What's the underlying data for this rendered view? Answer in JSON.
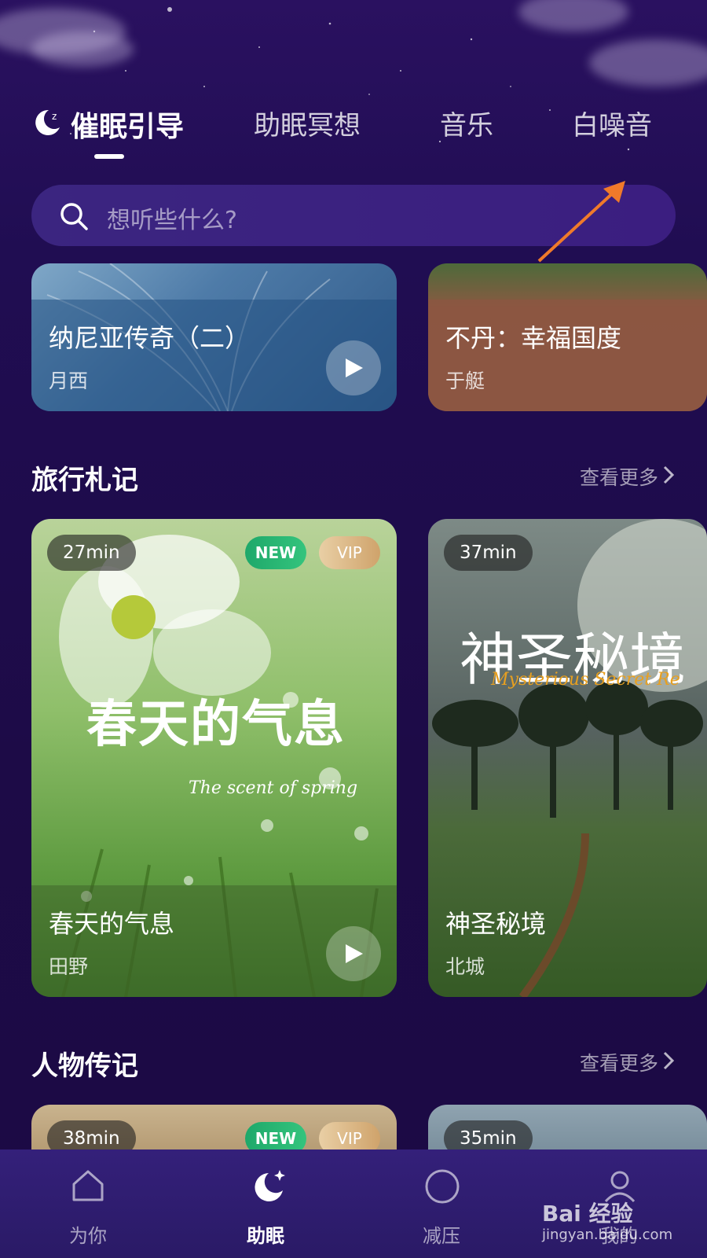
{
  "tabs": [
    {
      "label": "催眠引导",
      "active": true
    },
    {
      "label": "助眠冥想",
      "active": false
    },
    {
      "label": "音乐",
      "active": false
    },
    {
      "label": "白噪音",
      "active": false
    }
  ],
  "search": {
    "placeholder": "想听些什么?"
  },
  "top_cards": [
    {
      "title": "纳尼亚传奇（二）",
      "author": "月西"
    },
    {
      "title": "不丹：幸福国度",
      "author": "于艇"
    }
  ],
  "sections": [
    {
      "title": "旅行札记",
      "more": "查看更多",
      "cards": [
        {
          "duration": "27min",
          "new_badge": "NEW",
          "vip_badge": "VIP",
          "cover_title": "春天的气息",
          "cover_subtitle": "The scent of spring",
          "title": "春天的气息",
          "author": "田野"
        },
        {
          "duration": "37min",
          "cover_title": "神圣秘境",
          "cover_subtitle": "Mysterious Secret Re",
          "title": "神圣秘境",
          "author": "北城"
        }
      ]
    },
    {
      "title": "人物传记",
      "more": "查看更多",
      "cards": [
        {
          "duration": "38min",
          "new_badge": "NEW",
          "vip_badge": "VIP"
        },
        {
          "duration": "35min"
        }
      ]
    }
  ],
  "bottom_nav": [
    {
      "label": "为你",
      "icon": "home-icon",
      "active": false
    },
    {
      "label": "助眠",
      "icon": "moon-icon",
      "active": true
    },
    {
      "label": "减压",
      "icon": "circle-icon",
      "active": false
    },
    {
      "label": "我的",
      "icon": "profile-icon",
      "active": false
    }
  ],
  "watermark": {
    "brand": "Bai 经验",
    "url": "jingyan.baidu.com"
  },
  "colors": {
    "background": "#1e0a45",
    "accent_new": "#2bb673",
    "accent_vip": "#d9b27f",
    "arrow": "#f07a2a"
  }
}
